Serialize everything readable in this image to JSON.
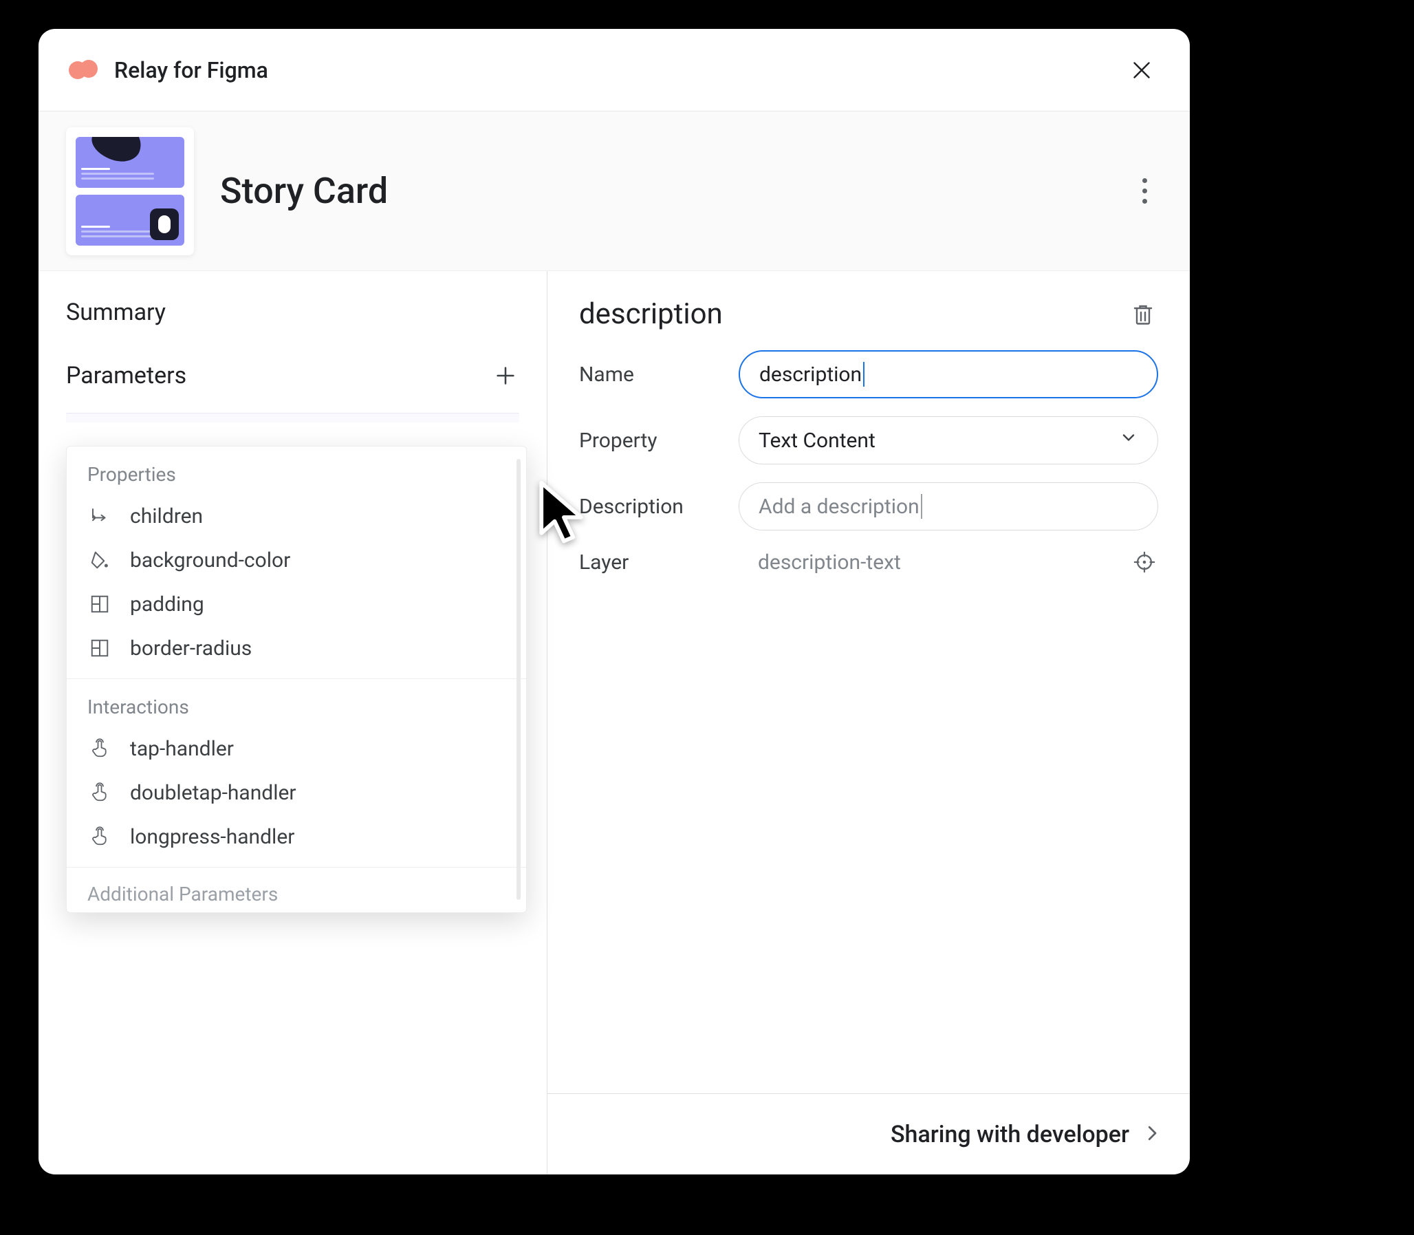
{
  "app": {
    "title": "Relay for Figma"
  },
  "component": {
    "name": "Story Card"
  },
  "sidebar": {
    "summary_label": "Summary",
    "parameters_label": "Parameters"
  },
  "popup": {
    "group1_title": "Properties",
    "properties": [
      {
        "label": "children"
      },
      {
        "label": "background-color"
      },
      {
        "label": "padding"
      },
      {
        "label": "border-radius"
      }
    ],
    "group2_title": "Interactions",
    "interactions": [
      {
        "label": "tap-handler"
      },
      {
        "label": "doubletap-handler"
      },
      {
        "label": "longpress-handler"
      }
    ],
    "cutoff_label": "Additional Parameters"
  },
  "detail": {
    "title": "description",
    "rows": {
      "name_label": "Name",
      "name_value": "description",
      "property_label": "Property",
      "property_value": "Text Content",
      "description_label": "Description",
      "description_placeholder": "Add a description",
      "layer_label": "Layer",
      "layer_value": "description-text"
    }
  },
  "footer": {
    "label": "Sharing with developer"
  }
}
